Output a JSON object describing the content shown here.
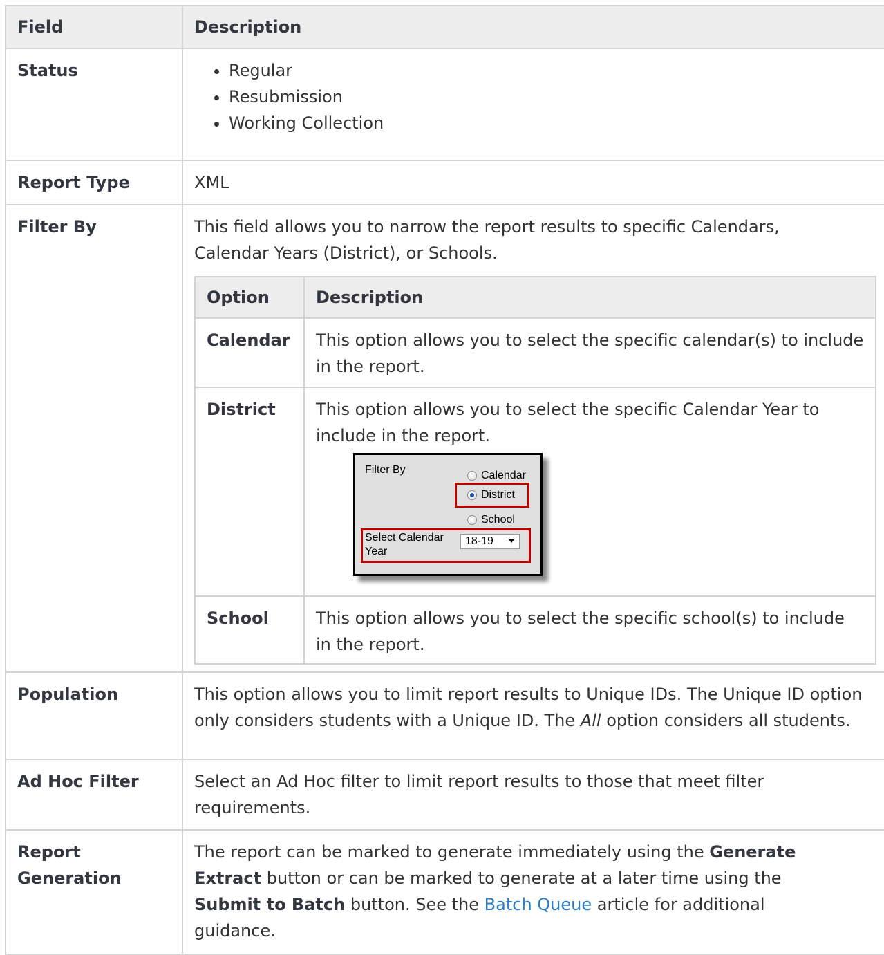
{
  "header": {
    "field": "Field",
    "description": "Description"
  },
  "rows": {
    "status": {
      "field": "Status",
      "items": [
        "Regular",
        "Resubmission",
        "Working Collection"
      ]
    },
    "report_type": {
      "field": "Report Type",
      "value": "XML"
    },
    "filter_by": {
      "field": "Filter By",
      "intro": "This field allows you to narrow the report results to specific Calendars, Calendar Years (District), or Schools.",
      "inner_header": {
        "option": "Option",
        "description": "Description"
      },
      "options": [
        {
          "name": "Calendar",
          "description": "This option allows you to select the specific calendar(s) to include in the report."
        },
        {
          "name": "District",
          "description": "This option allows you to select the specific Calendar Year to include in the report."
        },
        {
          "name": "School",
          "description": "This option allows you to select the specific school(s) to include in the report."
        }
      ],
      "screenshot": {
        "label": "Filter By",
        "radio_calendar": "Calendar",
        "radio_district": "District",
        "radio_school": "School",
        "year_label": "Select Calendar Year",
        "year_value": "18-19",
        "selected": "District"
      }
    },
    "population": {
      "field": "Population",
      "text_a": "This option allows you to limit report results to Unique IDs. The Unique ID option only considers students with a Unique ID. The ",
      "text_em": "All",
      "text_b": " option considers all students."
    },
    "ad_hoc": {
      "field": "Ad Hoc Filter",
      "value": "Select an Ad Hoc filter to limit report results to those that meet filter requirements."
    },
    "report_generation": {
      "field": "Report Generation",
      "t1": "The report can be marked to generate immediately using the ",
      "b1": "Generate Extract",
      "t2": " button or can be marked to generate at a later time using the ",
      "b2": "Submit to Batch",
      "t3": " button. See the ",
      "link": "Batch Queue",
      "t4": " article for additional guidance."
    }
  }
}
